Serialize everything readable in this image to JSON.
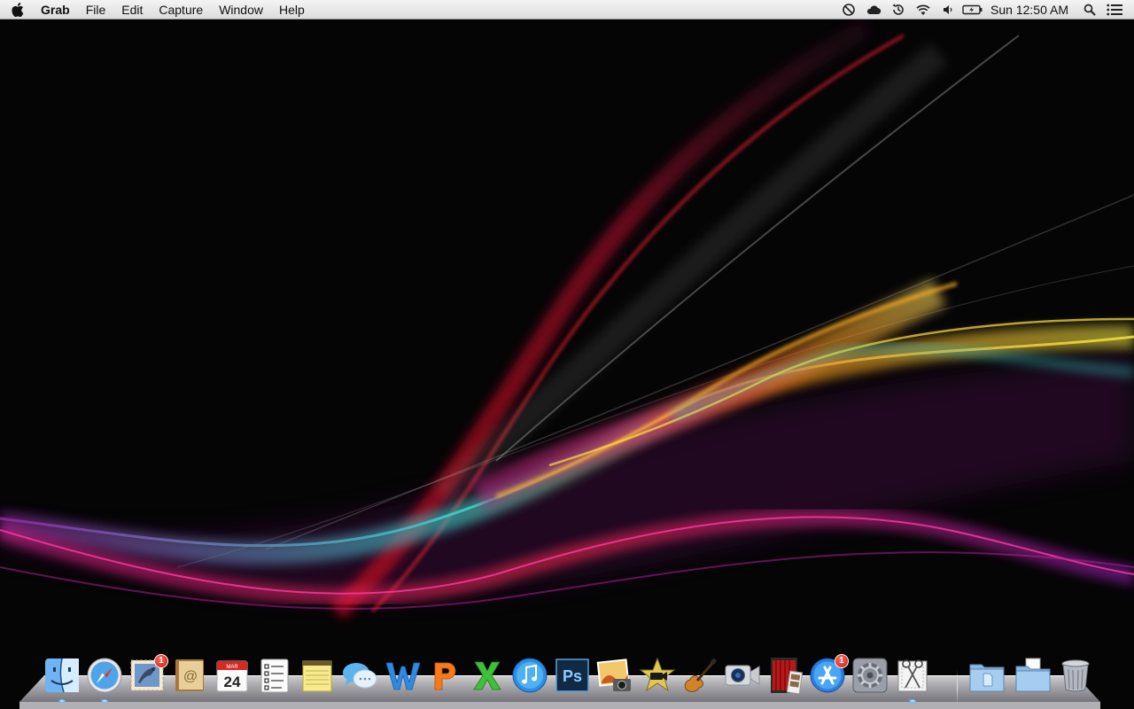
{
  "menubar": {
    "app_name": "Grab",
    "items": [
      "File",
      "Edit",
      "Capture",
      "Window",
      "Help"
    ],
    "status_icons": [
      "do-not-disturb-icon",
      "cloud-icon",
      "time-machine-icon",
      "wifi-icon",
      "volume-icon",
      "battery-icon"
    ],
    "clock": "Sun 12:50 AM"
  },
  "dock": {
    "calendar": {
      "month": "MAR",
      "day": "24"
    },
    "apps": [
      {
        "name": "Finder",
        "icon": "finder-icon",
        "running": true
      },
      {
        "name": "Safari",
        "icon": "safari-icon",
        "running": true
      },
      {
        "name": "Mail",
        "icon": "mail-icon",
        "badge": "1"
      },
      {
        "name": "Contacts",
        "icon": "contacts-icon"
      },
      {
        "name": "Calendar",
        "icon": "calendar-icon"
      },
      {
        "name": "Reminders",
        "icon": "reminders-icon"
      },
      {
        "name": "Notes",
        "icon": "notes-icon"
      },
      {
        "name": "Messages",
        "icon": "messages-icon"
      },
      {
        "name": "Word",
        "icon": "word-icon"
      },
      {
        "name": "PowerPoint",
        "icon": "powerpoint-icon"
      },
      {
        "name": "Excel",
        "icon": "excel-icon"
      },
      {
        "name": "iTunes",
        "icon": "itunes-icon"
      },
      {
        "name": "Photoshop",
        "icon": "photoshop-icon",
        "label": "Ps"
      },
      {
        "name": "iPhoto",
        "icon": "iphoto-icon"
      },
      {
        "name": "iMovie",
        "icon": "imovie-icon"
      },
      {
        "name": "GarageBand",
        "icon": "garageband-icon"
      },
      {
        "name": "FaceTime",
        "icon": "facetime-icon"
      },
      {
        "name": "Photo Booth",
        "icon": "photo-booth-icon"
      },
      {
        "name": "App Store",
        "icon": "app-store-icon",
        "badge": "1"
      },
      {
        "name": "System Preferences",
        "icon": "system-preferences-icon"
      },
      {
        "name": "Grab",
        "icon": "grab-icon",
        "running": true
      },
      {
        "name": "Documents",
        "icon": "documents-folder-icon"
      },
      {
        "name": "Downloads",
        "icon": "downloads-folder-icon"
      },
      {
        "name": "Trash",
        "icon": "trash-icon"
      }
    ]
  },
  "colors": {
    "menubar_bg": "#e8e8e8",
    "desktop_bg": "#050506",
    "badge_red": "#e0251b",
    "run_indicator": "#6fc8ff"
  }
}
